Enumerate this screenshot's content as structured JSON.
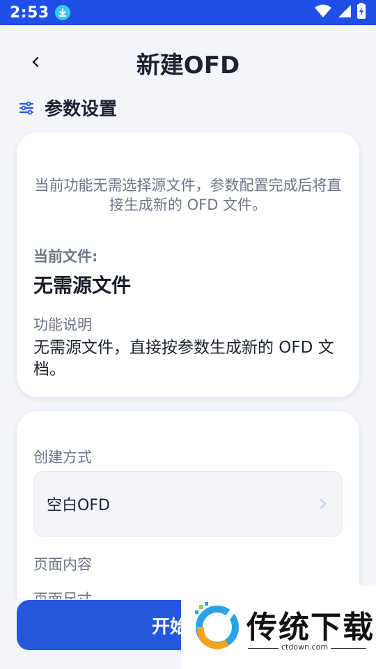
{
  "status_bar": {
    "time": "2:53",
    "download_icon": "download-icon",
    "wifi_icon": "wifi-icon",
    "signal_icon": "signal-icon",
    "battery_icon": "battery-charging-icon"
  },
  "header": {
    "title": "新建OFD",
    "back_icon": "chevron-left-icon"
  },
  "section": {
    "title": "参数设置",
    "icon": "sliders-icon"
  },
  "info_card": {
    "intro": "当前功能无需选择源文件，参数配置完成后将直接生成新的 OFD 文件。",
    "current_file_label": "当前文件:",
    "current_file_value": "无需源文件",
    "function_label": "功能说明",
    "function_desc": "无需源文件，直接按参数生成新的 OFD 文档。"
  },
  "params_card": {
    "create_label": "创建方式",
    "create_value": "空白OFD",
    "content_label": "页面内容",
    "size_label": "页面尺寸"
  },
  "start_button": {
    "label": "开始新建"
  },
  "watermark": {
    "text": "传统下载",
    "url": "ctdown.com"
  },
  "colors": {
    "primary": "#2457db",
    "status_bar": "#1f4fe6",
    "background": "#f3f5fa"
  }
}
